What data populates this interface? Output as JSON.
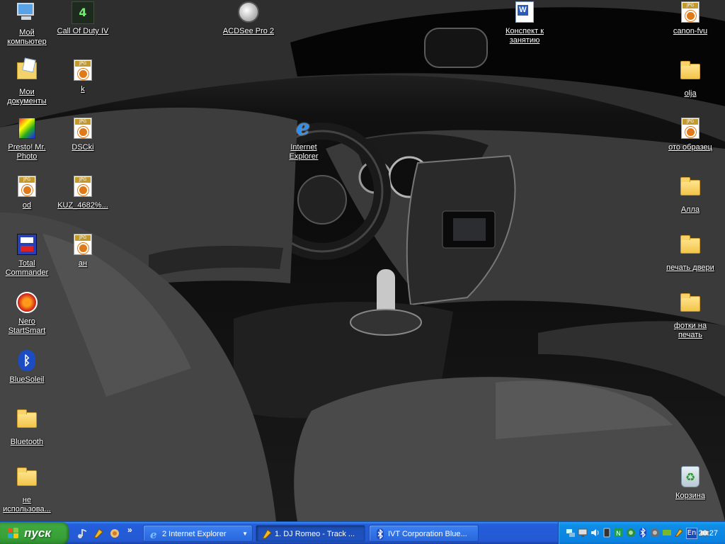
{
  "desktop": {
    "icons": [
      {
        "label": "Мой компьютер",
        "type": "computer"
      },
      {
        "label": "Мои документы",
        "type": "mydocs"
      },
      {
        "label": "Presto! Mr. Photo",
        "type": "presto"
      },
      {
        "label": "od",
        "type": "jpg"
      },
      {
        "label": "Total Commander",
        "type": "tc"
      },
      {
        "label": "Nero StartSmart",
        "type": "nero"
      },
      {
        "label": "BlueSoleil",
        "type": "bluetooth"
      },
      {
        "label": "Bluetooth",
        "type": "folder"
      },
      {
        "label": "не использова...",
        "type": "folder"
      },
      {
        "label": "Call Of Duty IV",
        "type": "cod"
      },
      {
        "label": "k",
        "type": "jpg"
      },
      {
        "label": "DSCki",
        "type": "jpg"
      },
      {
        "label": "KUZ_4682%...",
        "type": "jpg"
      },
      {
        "label": "ан",
        "type": "jpg"
      },
      {
        "label": "ACDSee Pro 2",
        "type": "acdsee"
      },
      {
        "label": "Internet Explorer",
        "type": "ie"
      },
      {
        "label": "Конспект к занятию",
        "type": "word"
      },
      {
        "label": "canon-fvu",
        "type": "jpg"
      },
      {
        "label": "olja",
        "type": "folder"
      },
      {
        "label": "ото образец",
        "type": "jpg"
      },
      {
        "label": "Алла",
        "type": "folder"
      },
      {
        "label": "печать двери",
        "type": "folder"
      },
      {
        "label": "фотки на печать",
        "type": "folder"
      },
      {
        "label": "Корзина",
        "type": "recycle-bin"
      }
    ],
    "icon_glyph_text": {
      "jpg": "JPG",
      "cod": "4",
      "ie": "e",
      "word": "W",
      "bluetooth": "ᛒ"
    }
  },
  "taskbar": {
    "start_label": "пуск",
    "quick_launch_more": "»",
    "tasks": [
      {
        "label": "2 Internet Explorer",
        "icon": "ie-icon",
        "active": false,
        "grouped": true
      },
      {
        "label": "1. DJ Romeo - Track ...",
        "icon": "winamp-icon",
        "active": true,
        "grouped": false
      },
      {
        "label": "IVT Corporation Blue...",
        "icon": "bluetooth-icon",
        "active": false,
        "grouped": false
      }
    ],
    "group_arrow": "▼",
    "language": "En",
    "clock": "20:27"
  },
  "colors": {
    "taskbar_blue": "#245edb",
    "start_green": "#3ea83e",
    "tray_blue": "#0f8de5"
  }
}
